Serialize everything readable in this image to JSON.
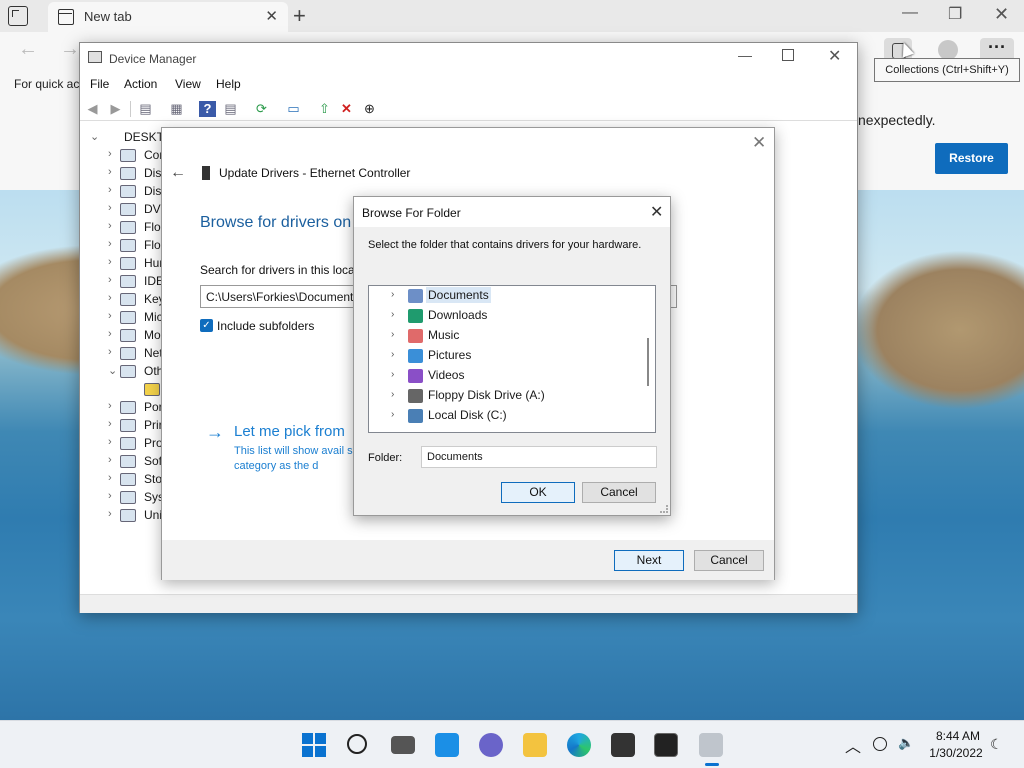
{
  "browser": {
    "tab_title": "New tab",
    "tab_close": "✕",
    "new_tab": "+",
    "minimize": "—",
    "maximize": "❐",
    "close": "✕",
    "back": "←",
    "forward": "→",
    "more": "···",
    "favbar_text": "For quick ac",
    "restore_message": "nexpectedly.",
    "restore_button": "Restore",
    "tooltip": "Collections (Ctrl+Shift+Y)"
  },
  "device_manager": {
    "title": "Device Manager",
    "menu": [
      "File",
      "Action",
      "View",
      "Help"
    ],
    "minimize": "—",
    "close": "✕",
    "toolbar_icons": [
      "back-arrow-icon",
      "forward-arrow-icon",
      "show-hide-tree-icon",
      "properties-icon",
      "help-icon",
      "view-icon",
      "scan-hardware-icon",
      "monitor-icon",
      "update-driver-icon",
      "uninstall-icon",
      "disable-device-icon"
    ],
    "root": "DESKTO",
    "nodes": [
      {
        "label": "Cor",
        "expanded": false
      },
      {
        "label": "Disk",
        "expanded": false
      },
      {
        "label": "Disp",
        "expanded": false
      },
      {
        "label": "DVD",
        "expanded": false
      },
      {
        "label": "Flop",
        "expanded": false
      },
      {
        "label": "Flop",
        "expanded": false
      },
      {
        "label": "Hun",
        "expanded": false
      },
      {
        "label": "IDE",
        "expanded": false
      },
      {
        "label": "Key",
        "expanded": false
      },
      {
        "label": "Mic",
        "expanded": false
      },
      {
        "label": "Mo",
        "expanded": false
      },
      {
        "label": "Net",
        "expanded": false
      },
      {
        "label": "Oth",
        "expanded": true
      },
      {
        "label": "",
        "expanded": false,
        "child": true
      },
      {
        "label": "Por",
        "expanded": false
      },
      {
        "label": "Prir",
        "expanded": false
      },
      {
        "label": "Pro",
        "expanded": false
      },
      {
        "label": "Soft",
        "expanded": false
      },
      {
        "label": "Stor",
        "expanded": false
      },
      {
        "label": "Syst",
        "expanded": false
      },
      {
        "label": "Uni",
        "expanded": false
      }
    ]
  },
  "wizard": {
    "close": "✕",
    "back": "←",
    "title": "Update Drivers - Ethernet Controller",
    "heading": "Browse for drivers on",
    "search_label": "Search for drivers in this loca",
    "path_value": "C:\\Users\\Forkies\\Document",
    "include_subfolders": "Include subfolders",
    "checkmark": "✓",
    "pick_arrow": "→",
    "pick_link": "Let me pick from",
    "pick_desc": "This list will show avail same category as the d",
    "next": "Next",
    "cancel": "Cancel"
  },
  "browse_for_folder": {
    "title": "Browse For Folder",
    "close": "✕",
    "instruction": "Select the folder that contains drivers for your hardware.",
    "items": [
      {
        "label": "Documents",
        "icon": "documents-folder-icon",
        "color": "#6d8fc7",
        "selected": true
      },
      {
        "label": "Downloads",
        "icon": "downloads-folder-icon",
        "color": "#1f9b6e",
        "selected": false
      },
      {
        "label": "Music",
        "icon": "music-folder-icon",
        "color": "#e06a6a",
        "selected": false
      },
      {
        "label": "Pictures",
        "icon": "pictures-folder-icon",
        "color": "#3a8fd8",
        "selected": false
      },
      {
        "label": "Videos",
        "icon": "videos-folder-icon",
        "color": "#8a4fc7",
        "selected": false
      },
      {
        "label": "Floppy Disk Drive (A:)",
        "icon": "floppy-drive-icon",
        "color": "#666666",
        "selected": false
      },
      {
        "label": "Local Disk (C:)",
        "icon": "local-disk-icon",
        "color": "#4a7fb5",
        "selected": false
      }
    ],
    "folder_label": "Folder:",
    "folder_value": "Documents",
    "ok": "OK",
    "cancel": "Cancel"
  },
  "taskbar": {
    "apps": [
      "start-icon",
      "search-icon",
      "task-view-icon",
      "widgets-icon",
      "teams-chat-icon",
      "file-explorer-icon",
      "edge-icon",
      "store-icon",
      "terminal-icon",
      "device-manager-icon"
    ],
    "tray_chevron": "︿",
    "time": "8:44 AM",
    "date": "1/30/2022"
  },
  "colors": {
    "accent": "#0f6cbd",
    "link": "#1b7fd1",
    "heading": "#1b5f9e"
  }
}
